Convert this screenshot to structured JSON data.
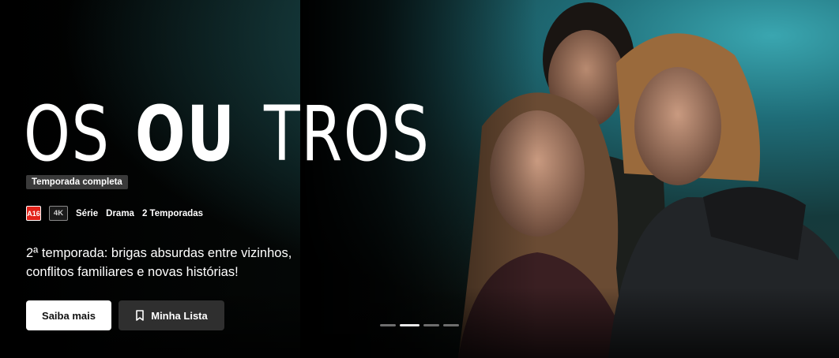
{
  "hero": {
    "logo": {
      "part1": "OS ",
      "part2": "OU",
      "part3": "TROS"
    },
    "badge": "Temporada completa",
    "rating": "A16",
    "quality": "4K",
    "tags": [
      "Série",
      "Drama",
      "2 Temporadas"
    ],
    "description": "2ª temporada: brigas absurdas entre vizinhos, conflitos familiares e novas histórias!",
    "buttons": {
      "more": "Saiba mais",
      "list": "Minha Lista"
    },
    "carousel": {
      "count": 4,
      "active_index": 1
    }
  }
}
